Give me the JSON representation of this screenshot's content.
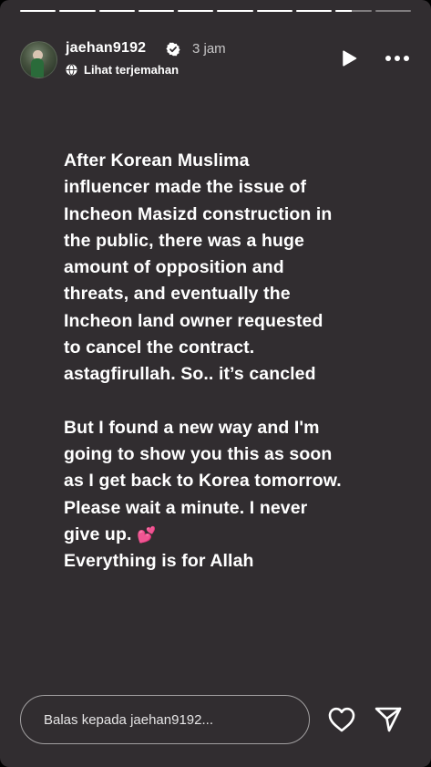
{
  "story": {
    "progress_segments": [
      1,
      1,
      1,
      1,
      1,
      1,
      1,
      1,
      0.45,
      0
    ],
    "username": "jaehan9192",
    "time_ago": "3 jam",
    "translate_label": "Lihat terjemahan",
    "verified": true
  },
  "content": {
    "paragraph1": [
      "After Korean Muslima",
      "influencer made the issue of",
      "Incheon Masizd construction in",
      "the public, there was a huge",
      "amount of opposition and",
      "threats, and eventually the",
      "Incheon land owner requested",
      "to cancel the contract.",
      "astagfirullah. So.. it’s cancled"
    ],
    "paragraph2": [
      "But I found a new way and I'm",
      "going to show you this as soon",
      "as I get back to Korea tomorrow.",
      "Please wait a minute. I never",
      "give up. 💕",
      "Everything is for Allah"
    ]
  },
  "reply": {
    "placeholder": "Balas kepada jaehan9192..."
  },
  "icons": {
    "verified": "verified-badge-icon",
    "translate": "globe-icon",
    "play": "play-icon",
    "more": "more-icon",
    "like": "heart-icon",
    "send": "send-icon"
  },
  "colors": {
    "background": "#312d30",
    "text": "#ffffff"
  }
}
